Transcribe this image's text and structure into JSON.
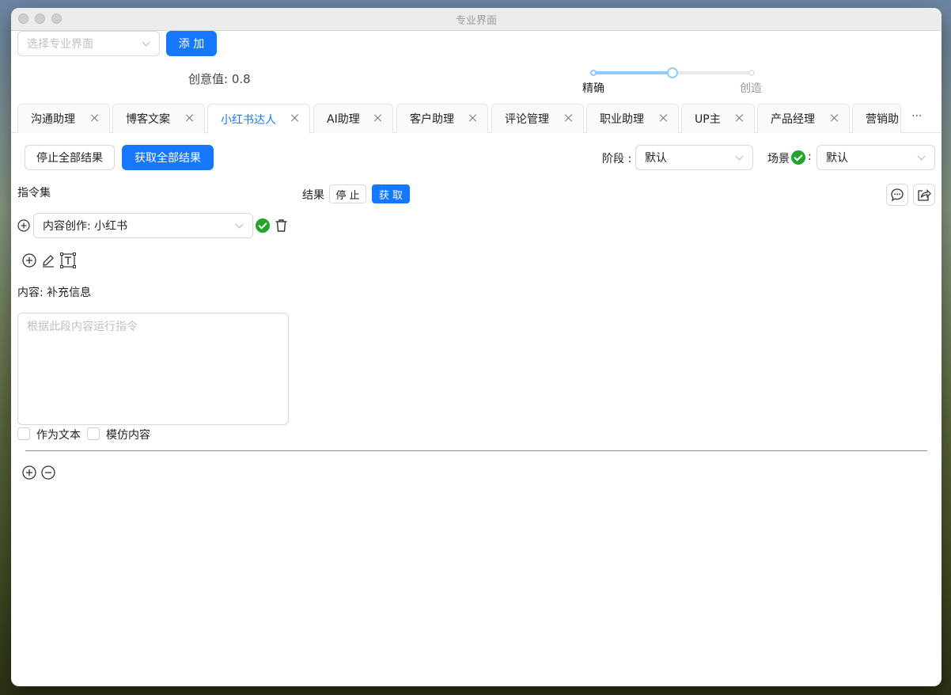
{
  "window": {
    "title": "专业界面"
  },
  "top": {
    "select_placeholder": "选择专业界面",
    "add_label": "添 加",
    "creativity_label": "创意值: 0.8",
    "creativity_value": 0.5,
    "slider_left_label": "精确",
    "slider_right_label": "创造"
  },
  "tabs": [
    {
      "label": "沟通助理"
    },
    {
      "label": "博客文案"
    },
    {
      "label": "小红书达人",
      "active": true
    },
    {
      "label": "AI助理"
    },
    {
      "label": "客户助理"
    },
    {
      "label": "评论管理"
    },
    {
      "label": "职业助理"
    },
    {
      "label": "UP主"
    },
    {
      "label": "产品经理"
    },
    {
      "label": "营销助"
    }
  ],
  "tabs_more": "···",
  "toolbar": {
    "stop_all_label": "停止全部结果",
    "fetch_all_label": "获取全部结果",
    "stage_label": "阶段 :",
    "stage_value": "默认",
    "scene_label": "场景",
    "scene_colon": ":",
    "scene_value": "默认"
  },
  "instructions": {
    "title": "指令集",
    "selected": "内容创作: 小红书",
    "content_label": "内容: 补充信息",
    "textarea_placeholder": "根据此段内容运行指令",
    "as_text_label": "作为文本",
    "imitate_label": "模仿内容"
  },
  "result": {
    "label": "结果",
    "stop_label": "停 止",
    "fetch_label": "获 取"
  },
  "colors": {
    "primary": "#1677ff",
    "success": "#22a52b",
    "slider_fill": "#91caff"
  }
}
